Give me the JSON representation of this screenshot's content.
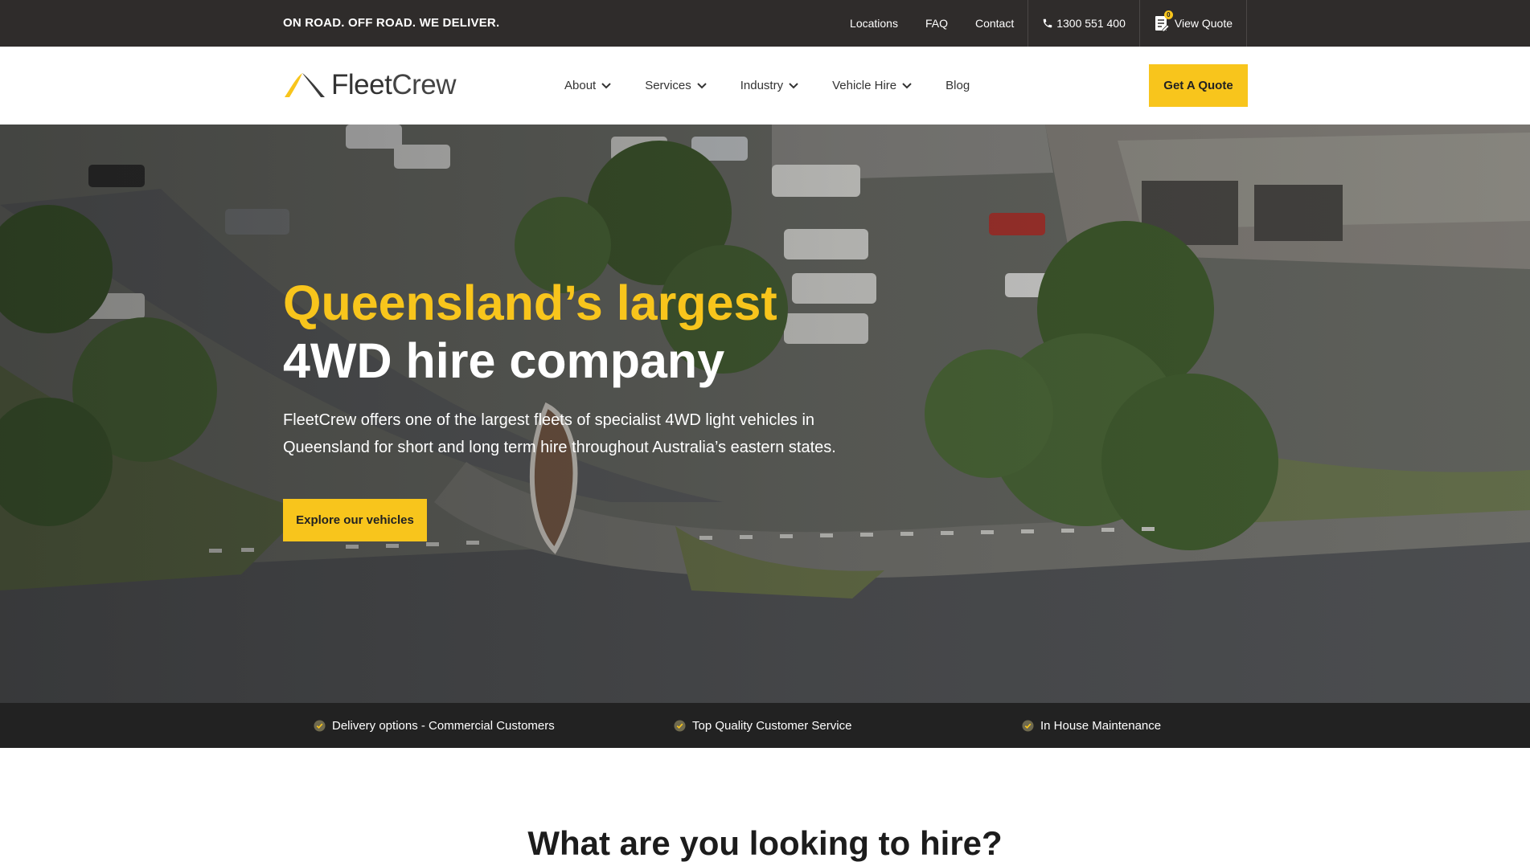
{
  "topbar": {
    "tagline": "ON ROAD. OFF ROAD. WE DELIVER.",
    "links": [
      "Locations",
      "FAQ",
      "Contact"
    ],
    "phone": "1300 551 400",
    "quote_label": "View Quote",
    "quote_count": "0"
  },
  "header": {
    "logo": {
      "part1": "Fleet",
      "part2": "Crew"
    },
    "nav": [
      {
        "label": "About",
        "dropdown": true
      },
      {
        "label": "Services",
        "dropdown": true
      },
      {
        "label": "Industry",
        "dropdown": true
      },
      {
        "label": "Vehicle Hire",
        "dropdown": true
      },
      {
        "label": "Blog",
        "dropdown": false
      }
    ],
    "cta_label": "Get A Quote"
  },
  "hero": {
    "title_line1": "Queensland’s largest",
    "title_line2": "4WD hire company",
    "description": "FleetCrew offers one of the largest fleets of specialist 4WD light vehicles in Queensland for short and long term hire throughout Australia’s eastern states.",
    "button_label": "Explore our vehicles"
  },
  "features": [
    "Delivery options - Commercial Customers",
    "Top Quality Customer Service",
    "In House Maintenance"
  ],
  "section": {
    "title": "What are you looking to hire?"
  },
  "colors": {
    "accent": "#f8c51c",
    "topbar_bg": "#2f2c2b",
    "strip_bg": "#222222"
  },
  "icons": {
    "phone": "phone-icon",
    "quote": "quote-list-icon",
    "chevron": "chevron-down-icon",
    "check": "check-circle-icon"
  }
}
